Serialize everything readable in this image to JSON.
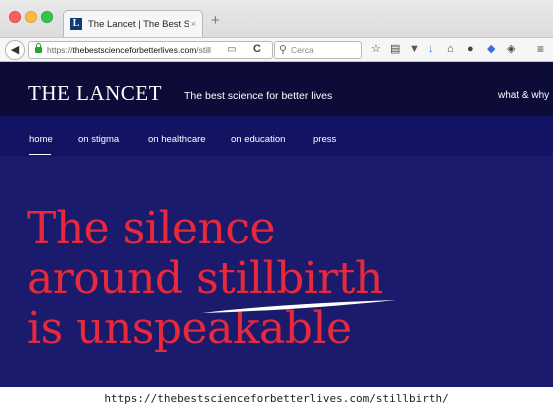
{
  "browser": {
    "tab_title": "The Lancet | The Best Scien...",
    "tab_close": "×",
    "new_tab": "+",
    "favicon_letter": "L",
    "url_prefix": "https://",
    "url_domain": "thebestscienceforbetterlives.com",
    "url_path": "/still",
    "search_placeholder": "Cerca"
  },
  "site": {
    "logo": "THE LANCET",
    "tagline": "The best science for better lives",
    "header_link": "what & why",
    "nav": [
      {
        "label": "home",
        "active": true
      },
      {
        "label": "on stigma"
      },
      {
        "label": "on healthcare"
      },
      {
        "label": "on education"
      },
      {
        "label": "press"
      }
    ],
    "headline": [
      "The silence",
      "around stillbirth",
      "is unspeakable"
    ],
    "colors": {
      "header_bg": "#0d0c38",
      "nav_bg": "#131363",
      "hero_bg": "#1a1b6c",
      "headline": "#e8283b"
    }
  },
  "caption": "https://thebestscienceforbetterlives.com/stillbirth/"
}
